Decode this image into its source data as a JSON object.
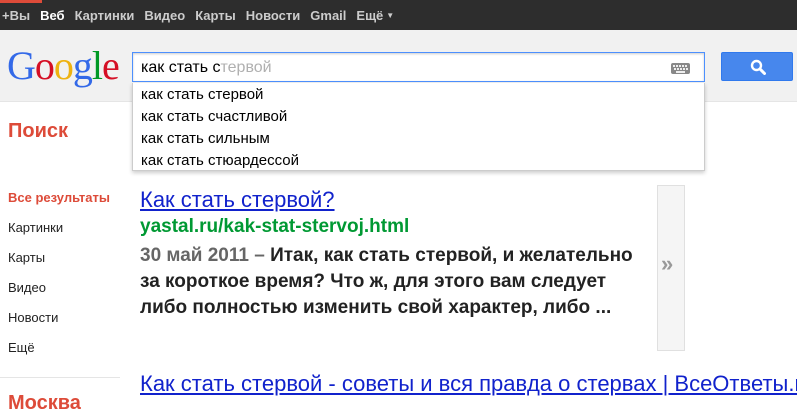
{
  "topbar": {
    "items": [
      "+Вы",
      "Веб",
      "Картинки",
      "Видео",
      "Карты",
      "Новости",
      "Gmail",
      "Ещё"
    ],
    "more_caret": "▼"
  },
  "logo": {
    "letters": [
      "G",
      "o",
      "o",
      "g",
      "l",
      "e"
    ]
  },
  "search": {
    "typed": "как стать с",
    "ghost": "тервой",
    "keyboard_icon": "keyboard-icon",
    "button_icon": "search-icon"
  },
  "suggestions": [
    "как стать стервой",
    "как стать счастливой",
    "как стать сильным",
    "как стать стюардессой"
  ],
  "left_nav": {
    "heading": "Поиск",
    "items": [
      "Все результаты",
      "Картинки",
      "Карты",
      "Видео",
      "Новости",
      "Ещё"
    ],
    "location": "Москва"
  },
  "results": [
    {
      "title": "Как стать стервой?",
      "url": "yastal.ru/kak-stat-stervoj.html",
      "date": "30 май 2011 –",
      "snippet": "Итак, как стать стервой, и желательно за короткое время? Что ж, для этого вам следует либо полностью изменить свой характер, либо ..."
    },
    {
      "title": "Как стать стервой - советы и вся правда о стервах | ВсеОтветы.ru"
    }
  ],
  "preview": {
    "arrow": "»"
  },
  "colors": {
    "topbar_bg": "#2d2d2d",
    "accent_red": "#dd4b39",
    "link_blue": "#1122cc",
    "url_green": "#009933",
    "button_blue": "#4787ed"
  }
}
